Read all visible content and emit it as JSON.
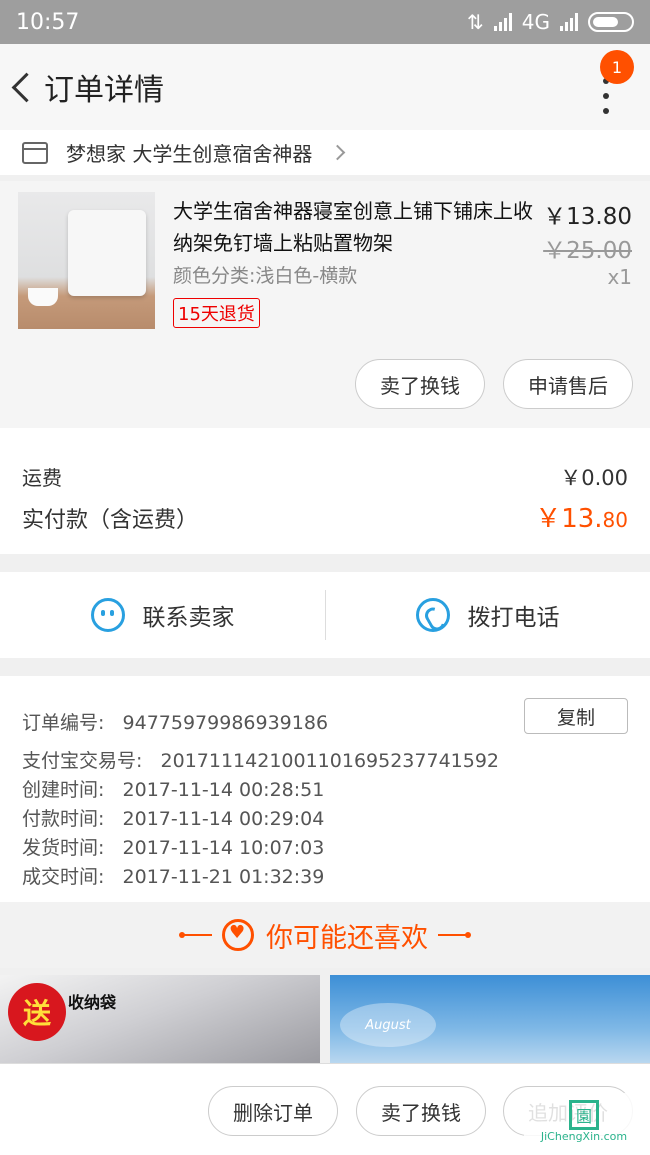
{
  "status_bar": {
    "time": "10:57",
    "network": "4G"
  },
  "nav": {
    "title": "订单详情",
    "badge_count": "1"
  },
  "shop": {
    "name": "梦想家 大学生创意宿舍神器"
  },
  "product": {
    "title": "大学生宿舍神器寝室创意上铺下铺床上收纳架免钉墙上粘贴置物架",
    "sku": "颜色分类:浅白色-横款",
    "tag": "15天退货",
    "price": "￥13.80",
    "original_price": "￥25.00",
    "quantity": "x1",
    "actions": [
      "卖了换钱",
      "申请售后"
    ]
  },
  "fees": {
    "shipping_label": "运费",
    "shipping_value": "￥0.00",
    "total_label": "实付款（含运费）",
    "total_main": "￥13.",
    "total_cents": "80"
  },
  "contact": {
    "seller": "联系卖家",
    "phone": "拨打电话"
  },
  "order_info": {
    "order_no_label": "订单编号:",
    "order_no": "94775979986939186",
    "copy_label": "复制",
    "alipay_label": "支付宝交易号:",
    "alipay_no": "2017111421001101695237741592",
    "created_label": "创建时间:",
    "created": "2017-11-14 00:28:51",
    "paid_label": "付款时间:",
    "paid": "2017-11-14 00:29:04",
    "shipped_label": "发货时间:",
    "shipped": "2017-11-14 10:07:03",
    "closed_label": "成交时间:",
    "closed": "2017-11-21 01:32:39"
  },
  "recommend": {
    "title": "你可能还喜欢",
    "left_badge": "送",
    "left_text": "收纳袋",
    "right_logo": "August"
  },
  "bottom_actions": [
    "删除订单",
    "卖了换钱",
    "追加评价"
  ],
  "watermark": {
    "text": "園",
    "sub": "JiChengXin.com"
  },
  "colors": {
    "accent": "#ff5000",
    "link_blue": "#29a0e0"
  }
}
